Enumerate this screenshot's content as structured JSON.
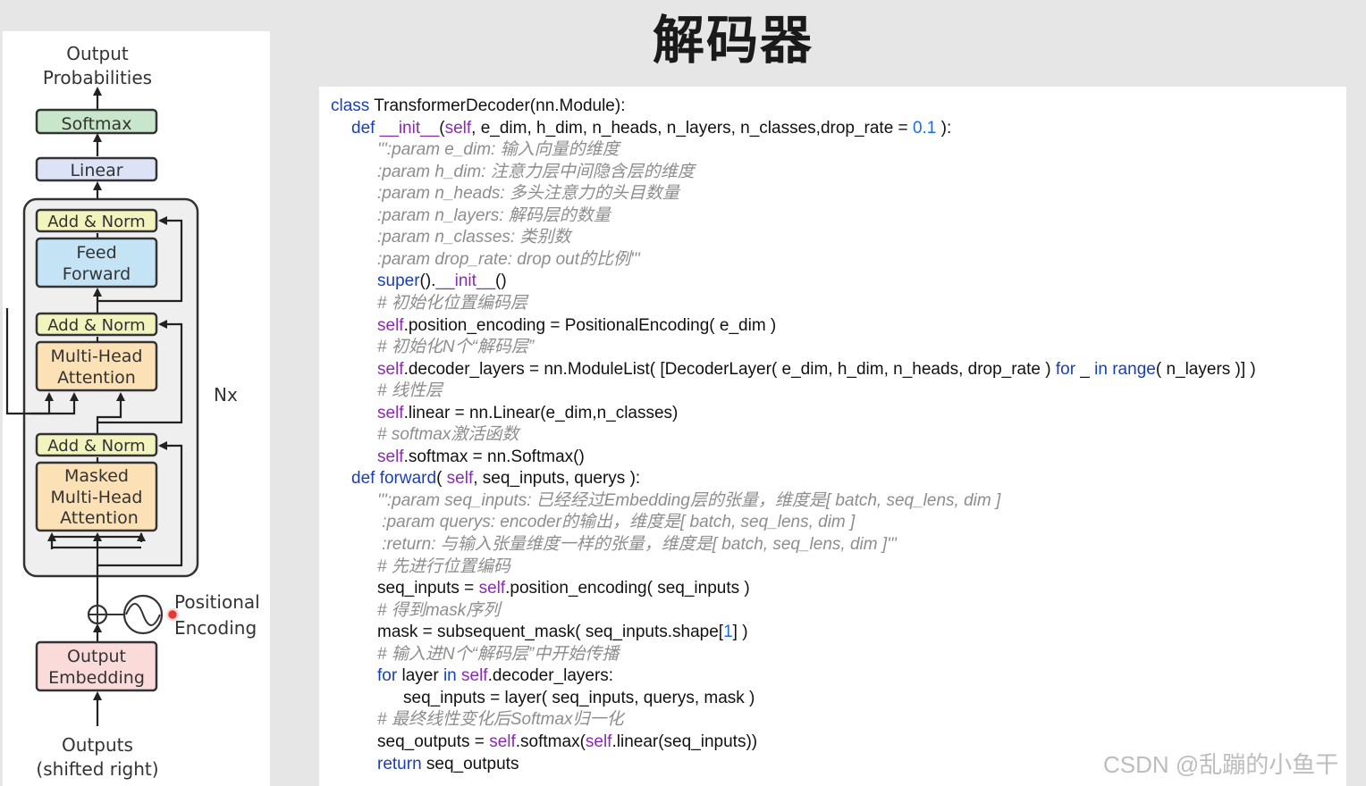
{
  "title": "解码器",
  "watermark": "CSDN @乱蹦的小鱼干",
  "colors": {
    "softmax_fill": "#c8e6c9",
    "linear_fill": "#dde3f6",
    "addnorm_fill": "#f3f3bd",
    "feedforward_fill": "#c4e4f6",
    "attention_fill": "#fce1b6",
    "embedding_fill": "#fbdada",
    "pointer_dot": "#e53935"
  },
  "diagram": {
    "output_probabilities": [
      "Output",
      "Probabilities"
    ],
    "softmax": "Softmax",
    "linear": "Linear",
    "add_norm": "Add & Norm",
    "feed_forward": [
      "Feed",
      "Forward"
    ],
    "multi_head_attention": [
      "Multi-Head",
      "Attention"
    ],
    "masked_attention": [
      "Masked",
      "Multi-Head",
      "Attention"
    ],
    "nx": "Nx",
    "positional_encoding": [
      "Positional",
      "Encoding"
    ],
    "output_embedding": [
      "Output",
      "Embedding"
    ],
    "outputs": [
      "Outputs",
      "(shifted right)"
    ]
  },
  "code": [
    {
      "indent": 0,
      "parts": [
        {
          "t": "class ",
          "c": "kw"
        },
        {
          "t": "TransformerDecoder(nn.Module):"
        }
      ]
    },
    {
      "indent": 1,
      "parts": [
        {
          "t": "def ",
          "c": "kw"
        },
        {
          "t": "__init__",
          "c": "sf"
        },
        {
          "t": "("
        },
        {
          "t": "self",
          "c": "sf"
        },
        {
          "t": ", e_dim, h_dim, n_heads, n_layers, n_classes,drop_rate = "
        },
        {
          "t": "0.1",
          "c": "nm"
        },
        {
          "t": " ):"
        }
      ]
    },
    {
      "indent": 2,
      "parts": [
        {
          "t": "''':param e_dim: 输入向量的维度",
          "c": "dc"
        }
      ]
    },
    {
      "indent": 2,
      "parts": [
        {
          "t": ":param h_dim: 注意力层中间隐含层的维度",
          "c": "dc"
        }
      ]
    },
    {
      "indent": 2,
      "parts": [
        {
          "t": ":param n_heads: 多头注意力的头目数量",
          "c": "dc"
        }
      ]
    },
    {
      "indent": 2,
      "parts": [
        {
          "t": ":param n_layers: 解码层的数量",
          "c": "dc"
        }
      ]
    },
    {
      "indent": 2,
      "parts": [
        {
          "t": ":param n_classes: 类别数",
          "c": "dc"
        }
      ]
    },
    {
      "indent": 2,
      "parts": [
        {
          "t": ":param drop_rate: drop out的比例'''",
          "c": "dc"
        }
      ]
    },
    {
      "indent": 2,
      "parts": [
        {
          "t": "super",
          "c": "kw"
        },
        {
          "t": "()."
        },
        {
          "t": "__init__",
          "c": "sf"
        },
        {
          "t": "()"
        }
      ]
    },
    {
      "indent": 2,
      "parts": [
        {
          "t": "# 初始化位置编码层",
          "c": "cm"
        }
      ]
    },
    {
      "indent": 2,
      "parts": [
        {
          "t": "self",
          "c": "sf"
        },
        {
          "t": ".position_encoding = PositionalEncoding( e_dim )"
        }
      ]
    },
    {
      "indent": 2,
      "parts": [
        {
          "t": "# 初始化N个“解码层”",
          "c": "cm"
        }
      ]
    },
    {
      "indent": 2,
      "parts": [
        {
          "t": "self",
          "c": "sf"
        },
        {
          "t": ".decoder_layers = nn.ModuleList( [DecoderLayer( e_dim, h_dim, n_heads, drop_rate ) "
        },
        {
          "t": "for",
          "c": "kw"
        },
        {
          "t": " _ "
        },
        {
          "t": "in",
          "c": "kw"
        },
        {
          "t": " "
        },
        {
          "t": "range",
          "c": "kw"
        },
        {
          "t": "( n_layers )] )"
        }
      ]
    },
    {
      "indent": 2,
      "parts": [
        {
          "t": "# 线性层",
          "c": "cm"
        }
      ]
    },
    {
      "indent": 2,
      "parts": [
        {
          "t": "self",
          "c": "sf"
        },
        {
          "t": ".linear = nn.Linear(e_dim,n_classes)"
        }
      ]
    },
    {
      "indent": 2,
      "parts": [
        {
          "t": "# softmax激活函数",
          "c": "cm"
        }
      ]
    },
    {
      "indent": 2,
      "parts": [
        {
          "t": "self",
          "c": "sf"
        },
        {
          "t": ".softmax = nn.Softmax()"
        }
      ]
    },
    {
      "indent": 1,
      "parts": [
        {
          "t": "def ",
          "c": "kw"
        },
        {
          "t": "forward",
          "c": "kw"
        },
        {
          "t": "( "
        },
        {
          "t": "self",
          "c": "sf"
        },
        {
          "t": ", seq_inputs, querys ):"
        }
      ]
    },
    {
      "indent": 2,
      "parts": [
        {
          "t": "''':param seq_inputs: 已经经过Embedding层的张量，维度是[ batch, seq_lens, dim ]",
          "c": "dc"
        }
      ]
    },
    {
      "indent": 2,
      "parts": [
        {
          "t": " :param querys: encoder的输出，维度是[ batch, seq_lens, dim ]",
          "c": "dc"
        }
      ]
    },
    {
      "indent": 2,
      "parts": [
        {
          "t": " :return: 与输入张量维度一样的张量，维度是[ batch, seq_lens, dim ]'''",
          "c": "dc"
        }
      ]
    },
    {
      "indent": 2,
      "parts": [
        {
          "t": "# 先进行位置编码",
          "c": "cm"
        }
      ]
    },
    {
      "indent": 2,
      "parts": [
        {
          "t": "seq_inputs = "
        },
        {
          "t": "self",
          "c": "sf"
        },
        {
          "t": ".position_encoding( seq_inputs )"
        }
      ]
    },
    {
      "indent": 2,
      "parts": [
        {
          "t": "# 得到mask序列",
          "c": "cm"
        }
      ]
    },
    {
      "indent": 2,
      "parts": [
        {
          "t": "mask = subsequent_mask( seq_inputs.shape["
        },
        {
          "t": "1",
          "c": "nm"
        },
        {
          "t": "] )"
        }
      ]
    },
    {
      "indent": 2,
      "parts": [
        {
          "t": "# 输入进N个“解码层”中开始传播",
          "c": "cm"
        }
      ]
    },
    {
      "indent": 2,
      "parts": [
        {
          "t": "for",
          "c": "kw"
        },
        {
          "t": " layer "
        },
        {
          "t": "in",
          "c": "kw"
        },
        {
          "t": " "
        },
        {
          "t": "self",
          "c": "sf"
        },
        {
          "t": ".decoder_layers:"
        }
      ]
    },
    {
      "indent": 3,
      "parts": [
        {
          "t": "seq_inputs = layer( seq_inputs, querys, mask )"
        }
      ]
    },
    {
      "indent": 2,
      "parts": [
        {
          "t": "# 最终线性变化后Softmax归一化",
          "c": "cm"
        }
      ]
    },
    {
      "indent": 2,
      "parts": [
        {
          "t": "seq_outputs = "
        },
        {
          "t": "self",
          "c": "sf"
        },
        {
          "t": ".softmax("
        },
        {
          "t": "self",
          "c": "sf"
        },
        {
          "t": ".linear(seq_inputs))"
        }
      ]
    },
    {
      "indent": 2,
      "parts": [
        {
          "t": "return",
          "c": "kw"
        },
        {
          "t": " seq_outputs"
        }
      ]
    }
  ]
}
